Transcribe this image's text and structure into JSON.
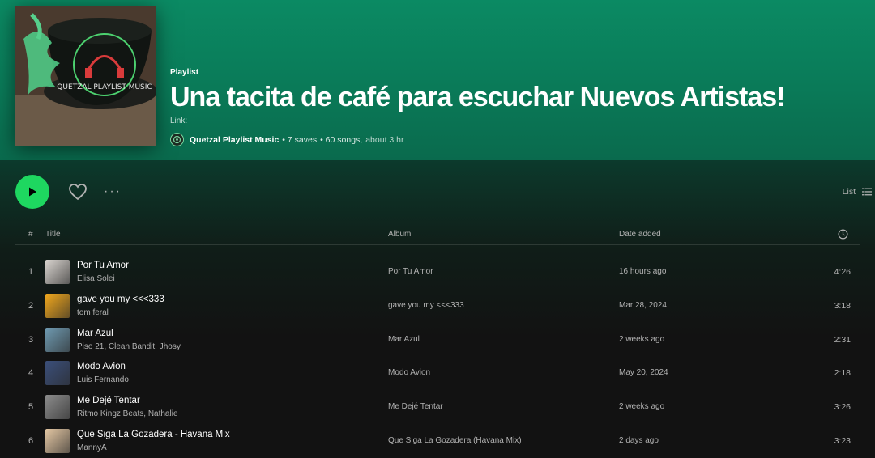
{
  "playlist": {
    "type": "Playlist",
    "title": "Una tacita de café para escuchar Nuevos Artistas!",
    "description": "Link:",
    "owner": "Quetzal Playlist Music",
    "saves": "• 7 saves",
    "songs": "• 60 songs,",
    "duration": "about 3 hr",
    "cover_text": "QUETZAL PLAYLIST MUSIC"
  },
  "controls": {
    "view_label": "List",
    "more_label": "···"
  },
  "table": {
    "headers": {
      "num": "#",
      "title": "Title",
      "album": "Album",
      "date": "Date added"
    }
  },
  "tracks": [
    {
      "num": "1",
      "title": "Por Tu Amor",
      "artist": "Elisa Solei",
      "album": "Por Tu Amor",
      "date": "16 hours ago",
      "duration": "4:26",
      "thumb_color": "#d9d4cf"
    },
    {
      "num": "2",
      "title": "gave you my <<<333",
      "artist": "tom feral",
      "album": "gave you my <<<333",
      "date": "Mar 28, 2024",
      "duration": "3:18",
      "thumb_color": "#f2a81d"
    },
    {
      "num": "3",
      "title": "Mar Azul",
      "artist": "Piso 21, Clean Bandit, Jhosy",
      "album": "Mar Azul",
      "date": "2 weeks ago",
      "duration": "2:31",
      "thumb_color": "#6f9ab1"
    },
    {
      "num": "4",
      "title": "Modo Avion",
      "artist": "Luis Fernando",
      "album": "Modo Avion",
      "date": "May 20, 2024",
      "duration": "2:18",
      "thumb_color": "#3b4f7a"
    },
    {
      "num": "5",
      "title": "Me Dejé Tentar",
      "artist": "Ritmo Kingz Beats, Nathalie",
      "album": "Me Dejé Tentar",
      "date": "2 weeks ago",
      "duration": "3:26",
      "thumb_color": "#8c8c8c"
    },
    {
      "num": "6",
      "title": "Que Siga La Gozadera - Havana Mix",
      "artist": "MannyA",
      "album": "Que Siga La Gozadera (Havana Mix)",
      "date": "2 days ago",
      "duration": "3:23",
      "thumb_color": "#e4c7a3"
    }
  ],
  "colors": {
    "accent": "#1ed760",
    "header_bg": "#0b8a63",
    "body_bg": "#121212"
  }
}
